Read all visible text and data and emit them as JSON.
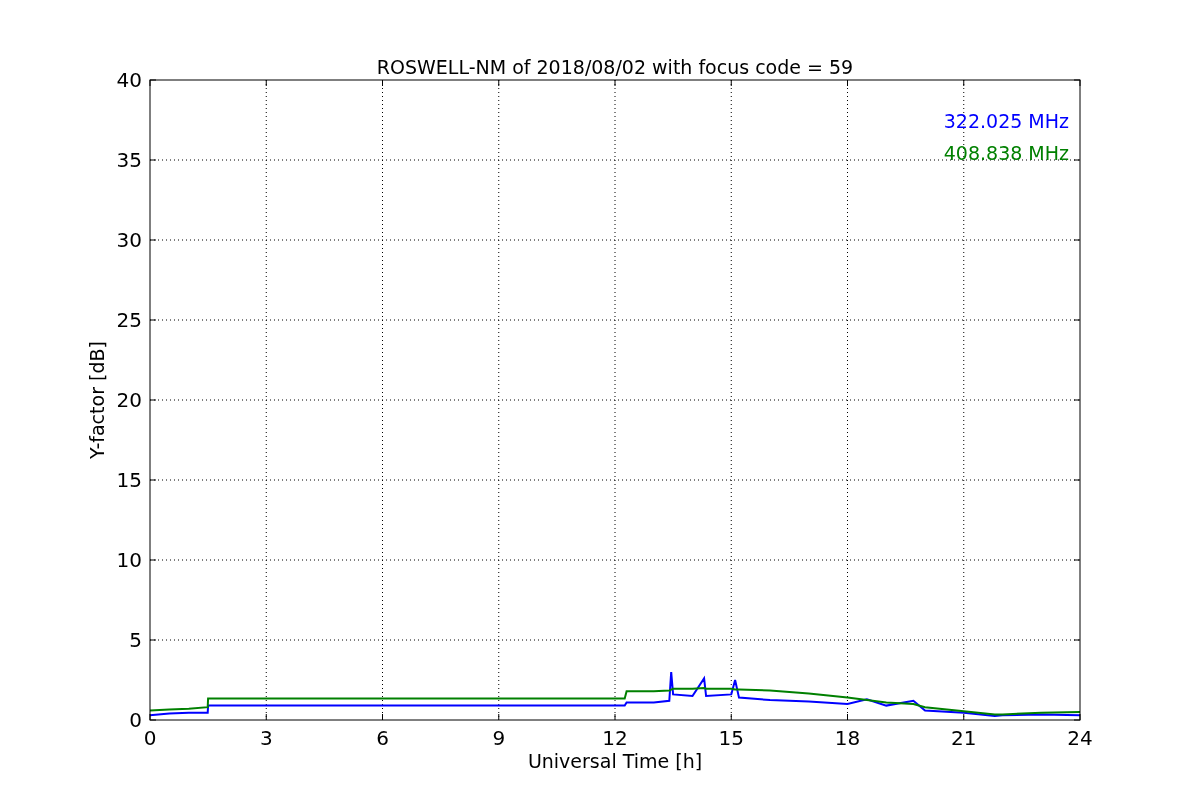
{
  "chart_data": {
    "type": "line",
    "title": "ROSWELL-NM of 2018/08/02 with focus code = 59",
    "xlabel": "Universal Time [h]",
    "ylabel": "Y-factor [dB]",
    "x": [
      0,
      0.5,
      1,
      1.49,
      1.5,
      6,
      12.25,
      12.3,
      13,
      13.4,
      13.45,
      13.5,
      14,
      14.3,
      14.35,
      15,
      15.1,
      15.2,
      16,
      17,
      18,
      18.5,
      19,
      19.7,
      20,
      21,
      21.8,
      22,
      23,
      24
    ],
    "series": [
      {
        "name": "322.025 MHz",
        "color": "#0000ff",
        "values": [
          0.3,
          0.4,
          0.45,
          0.45,
          0.9,
          0.9,
          0.9,
          1.1,
          1.1,
          1.2,
          3.0,
          1.6,
          1.5,
          2.6,
          1.5,
          1.6,
          2.5,
          1.4,
          1.25,
          1.15,
          1.0,
          1.3,
          0.9,
          1.2,
          0.6,
          0.45,
          0.25,
          0.3,
          0.35,
          0.3
        ]
      },
      {
        "name": "408.838 MHz",
        "color": "#008000",
        "values": [
          0.6,
          0.65,
          0.7,
          0.8,
          1.35,
          1.35,
          1.35,
          1.8,
          1.8,
          1.85,
          1.9,
          1.95,
          1.95,
          2.0,
          1.95,
          1.95,
          1.9,
          1.9,
          1.85,
          1.65,
          1.4,
          1.25,
          1.1,
          1.0,
          0.8,
          0.55,
          0.35,
          0.35,
          0.45,
          0.5
        ]
      }
    ],
    "xlim": [
      0,
      24
    ],
    "ylim": [
      0,
      40
    ],
    "xticks": [
      0,
      3,
      6,
      9,
      12,
      15,
      18,
      21,
      24
    ],
    "yticks": [
      0,
      5,
      10,
      15,
      20,
      25,
      30,
      35,
      40
    ],
    "grid": true
  }
}
